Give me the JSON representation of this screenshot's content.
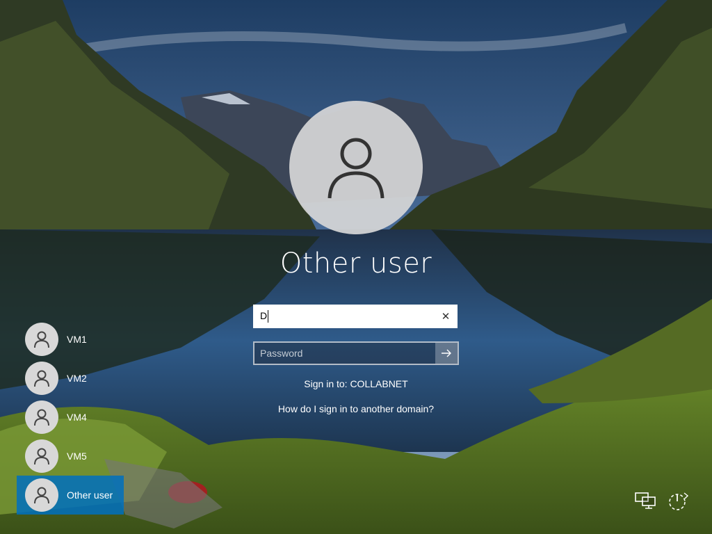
{
  "login": {
    "title": "Other user",
    "username_value": "D",
    "username_clear_icon": "close-icon",
    "password_placeholder": "Password",
    "submit_icon": "arrow-right-icon",
    "sign_in_to": "Sign in to: COLLABNET",
    "another_domain_link": "How do I sign in to another domain?"
  },
  "users": [
    {
      "name": "VM1",
      "icon": "user-icon",
      "selected": false
    },
    {
      "name": "VM2",
      "icon": "user-icon",
      "selected": false
    },
    {
      "name": "VM4",
      "icon": "user-icon",
      "selected": false
    },
    {
      "name": "VM5",
      "icon": "user-icon",
      "selected": false
    },
    {
      "name": "Other user",
      "icon": "user-icon",
      "selected": true
    }
  ],
  "system_icons": [
    "network-icon",
    "power-icon"
  ],
  "colors": {
    "accent_selected": "#0070be",
    "avatar_bg": "#d7d7d7"
  }
}
